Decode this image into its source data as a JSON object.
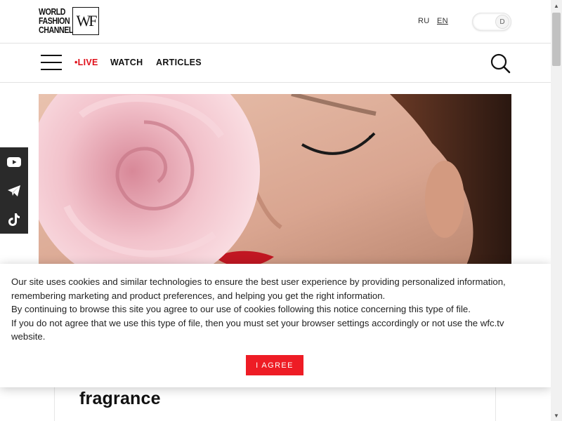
{
  "header": {
    "logo_text": "WORLD FASHION CHANNEL",
    "logo_mark": "WF",
    "languages": [
      "RU",
      "EN"
    ],
    "active_language": "EN",
    "theme_toggle_label": "D"
  },
  "nav": {
    "items": [
      "•LIVE",
      "WATCH",
      "ARTICLES"
    ],
    "live_color": "#e0101a"
  },
  "social": {
    "icons": [
      "youtube-icon",
      "telegram-icon",
      "tiktok-icon"
    ]
  },
  "article": {
    "title_visible": "fragrance"
  },
  "cookie": {
    "paragraphs": [
      "Our site uses cookies and similar technologies to ensure the best user experience by providing personalized information, remembering marketing and product preferences, and helping you get the right information.",
      "By continuing to browse this site you agree to our use of cookies following this notice concerning this type of file.",
      "If you do not agree that we use this type of file, then you must set your browser settings accordingly or not use the wfc.tv website."
    ],
    "button_label": "I AGREE",
    "button_color": "#ee1c25"
  }
}
